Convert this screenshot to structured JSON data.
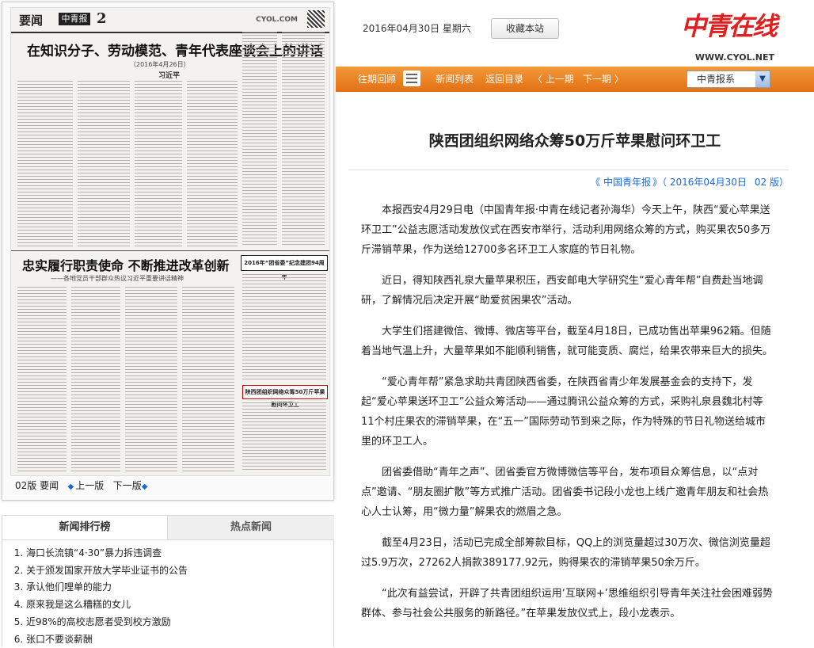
{
  "paper": {
    "section": "要闻",
    "logo_text": "中青报",
    "page_num": "2",
    "url": "CYOL.COM",
    "title1": "在知识分子、劳动模范、青年代表座谈会上的讲话",
    "subtitle1": "（2016年4月26日）",
    "author": "习近平",
    "title2": "忠实履行职责使命 不断推进改革创新",
    "subtitle2": "——各地党员干部群众热议习近平重要讲话精神",
    "box_text": "2016年“团省委”纪念建团94周年",
    "box2_text": "陕西团组织网络众筹50万斤苹果慰问环卫工",
    "nav_page": "02版 要闻",
    "nav_prev": "上一版",
    "nav_next": "下一版"
  },
  "rank": {
    "tab1": "新闻排行榜",
    "tab2": "热点新闻",
    "items": [
      "海口长流镇“4·30”暴力拆违调查",
      "关于颁发国家开放大学毕业证书的公告",
      "承认他们哩单的能力",
      "原来我是这么糟糕的女儿",
      "近98%的高校志愿者受到校方激励",
      "张口不要谈薪酬"
    ]
  },
  "header": {
    "date": "2016年04月30日  星期六",
    "fav_button": "收藏本站",
    "logo_cn": "中青在线",
    "logo_url": "WWW.CYOL.NET"
  },
  "nav": {
    "history": "往期回顾",
    "news_list": "新闻列表",
    "back_toc": "返回目录",
    "prev": "〈 上一期",
    "next": "下一期 〉",
    "paper_select": "中青报系"
  },
  "article": {
    "title": "陕西团组织网络众筹50万斤苹果慰问环卫工",
    "meta_open": "《",
    "source": "中国青年报",
    "meta_date": "》（ 2016年04月30日",
    "meta_page": "02 版）",
    "paragraphs": [
      "本报西安4月29日电（中国青年报·中青在线记者孙海华）今天上午，陕西“爱心苹果送环卫工”公益志愿活动发放仪式在西安市举行，活动利用网络众筹的方式，购买果农50多万斤滞销苹果，作为送给12700多名环卫工人家庭的节日礼物。",
      "近日，得知陕西礼泉大量苹果积压，西安邮电大学研究生“爱心青年帮”自费赴当地调研，了解情况后决定开展“助爱贫困果农”活动。",
      "大学生们搭建微信、微博、微店等平台，截至4月18日，已成功售出苹果962箱。但随着当地气温上升，大量苹果如不能顺利销售，就可能变质、腐烂，给果农带来巨大的损失。",
      "“爱心青年帮”紧急求助共青团陕西省委，在陕西省青少年发展基金会的支持下，发起“爱心苹果送环卫工”公益众筹活动——通过腾讯公益众筹的方式，采购礼泉县魏北村等11个村庄果农的滞销苹果，在“五一”国际劳动节到来之际，作为特殊的节日礼物送给城市里的环卫工人。",
      "团省委借助“青年之声”、团省委官方微博微信等平台，发布项目众筹信息，以“点对点”邀请、“朋友圈扩散”等方式推广活动。团省委书记段小龙也上线广邀青年朋友和社会热心人士认筹，用“微力量”解果农的燃眉之急。",
      "截至4月23日，活动已完成全部筹款目标，QQ上的浏览量超过30万次、微信浏览量超过5.9万次，27262人捐款389177.92元，购得果农的滞销苹果50余万斤。",
      "“此次有益尝试，开辟了共青团组织运用‘互联网+’思维组织引导青年关注社会困难弱势群体、参与社会公共服务的新路径。”在苹果发放仪式上，段小龙表示。"
    ]
  }
}
